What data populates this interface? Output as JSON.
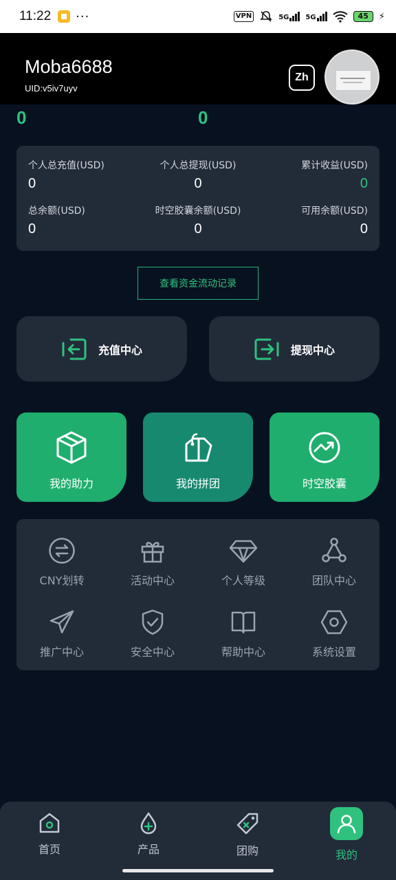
{
  "status_bar": {
    "time": "11:22",
    "dots": "···",
    "vpn": "VPN",
    "signal1": "5G",
    "signal2": "5G",
    "battery": "45"
  },
  "header": {
    "username": "Moba6688",
    "uid": "UID:v5iv7uyv",
    "lang": "Zh"
  },
  "summary": {
    "left_value": "0",
    "right_value": "0"
  },
  "stats": {
    "total_recharge_label": "个人总充值(USD)",
    "total_recharge": "0",
    "total_withdraw_label": "个人总提现(USD)",
    "total_withdraw": "0",
    "total_income_label": "累计收益(USD)",
    "total_income": "0",
    "total_balance_label": "总余额(USD)",
    "total_balance": "0",
    "capsule_balance_label": "时空胶囊余额(USD)",
    "capsule_balance": "0",
    "available_balance_label": "可用余额(USD)",
    "available_balance": "0"
  },
  "flow_button": "查看资金流动记录",
  "actions": {
    "recharge": "充值中心",
    "withdraw": "提现中心"
  },
  "features": {
    "assist": "我的助力",
    "group": "我的拼团",
    "capsule": "时空胶囊"
  },
  "menu": {
    "cny_transfer": "CNY划转",
    "activity": "活动中心",
    "level": "个人等级",
    "team": "团队中心",
    "promotion": "推广中心",
    "security": "安全中心",
    "help": "帮助中心",
    "settings": "系统设置"
  },
  "tabs": {
    "home": "首页",
    "products": "产品",
    "groupbuy": "团购",
    "mine": "我的"
  },
  "colors": {
    "accent": "#2ec27e",
    "card": "#222b38",
    "background": "#081120"
  }
}
